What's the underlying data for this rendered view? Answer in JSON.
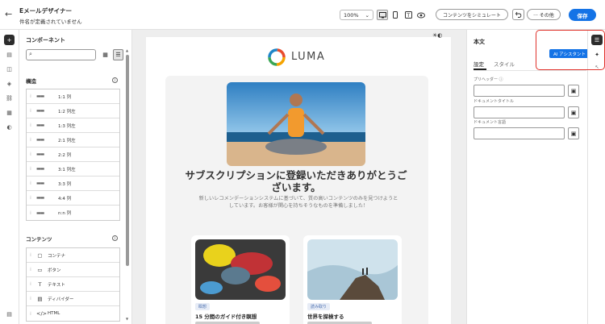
{
  "header": {
    "back_label": "←",
    "title": "Eメールデザイナー",
    "subtitle": "件名が定義されていません",
    "zoom": "100%",
    "simulate_label": "コンテンツをシミュレート",
    "more_label": "··· その他",
    "save_label": "保存"
  },
  "components": {
    "title": "コンポーネント",
    "search_placeholder": "",
    "structure_title": "構造",
    "structure_items": [
      {
        "icon": "▬▬",
        "label": "1:1 列"
      },
      {
        "icon": "▬▬",
        "label": "1:2 列左"
      },
      {
        "icon": "▬▬",
        "label": "1:3 列左"
      },
      {
        "icon": "▬▬",
        "label": "2:1 列左"
      },
      {
        "icon": "▬▬",
        "label": "2:2 列"
      },
      {
        "icon": "▬▬",
        "label": "3:1 列左"
      },
      {
        "icon": "▬▬",
        "label": "3:3 列"
      },
      {
        "icon": "▬▬",
        "label": "4:4 列"
      },
      {
        "icon": "▬▬",
        "label": "n:n 列"
      }
    ],
    "content_title": "コンテンツ",
    "content_items": [
      {
        "icon": "▢",
        "label": "コンテナ"
      },
      {
        "icon": "▭",
        "label": "ボタン"
      },
      {
        "icon": "T",
        "label": "テキスト"
      },
      {
        "icon": "▤",
        "label": "ディバイダー"
      },
      {
        "icon": "</>",
        "label": "HTML"
      }
    ]
  },
  "canvas": {
    "brand": "LUMA",
    "headline": "サブスクリプションに登録いただきありがとうございます。",
    "description": "新しいレコメンデーションシステムに基づいて、質の高いコンテンツのみを見つけようとしています。お客様が関心を持ちそうなものを準備しました！",
    "products": [
      {
        "badge": "瞑想",
        "title": "15 分間のガイド付き瞑想"
      },
      {
        "badge": "読み取り",
        "title": "世界を探検する"
      }
    ]
  },
  "panel": {
    "title": "本文",
    "tabs": [
      "設定",
      "スタイル"
    ],
    "ai_label": "AI アシスタント",
    "fields": [
      {
        "label": "プリヘッダー"
      },
      {
        "label": "ドキュメントタイトル"
      },
      {
        "label": "ドキュメント言語"
      }
    ]
  }
}
